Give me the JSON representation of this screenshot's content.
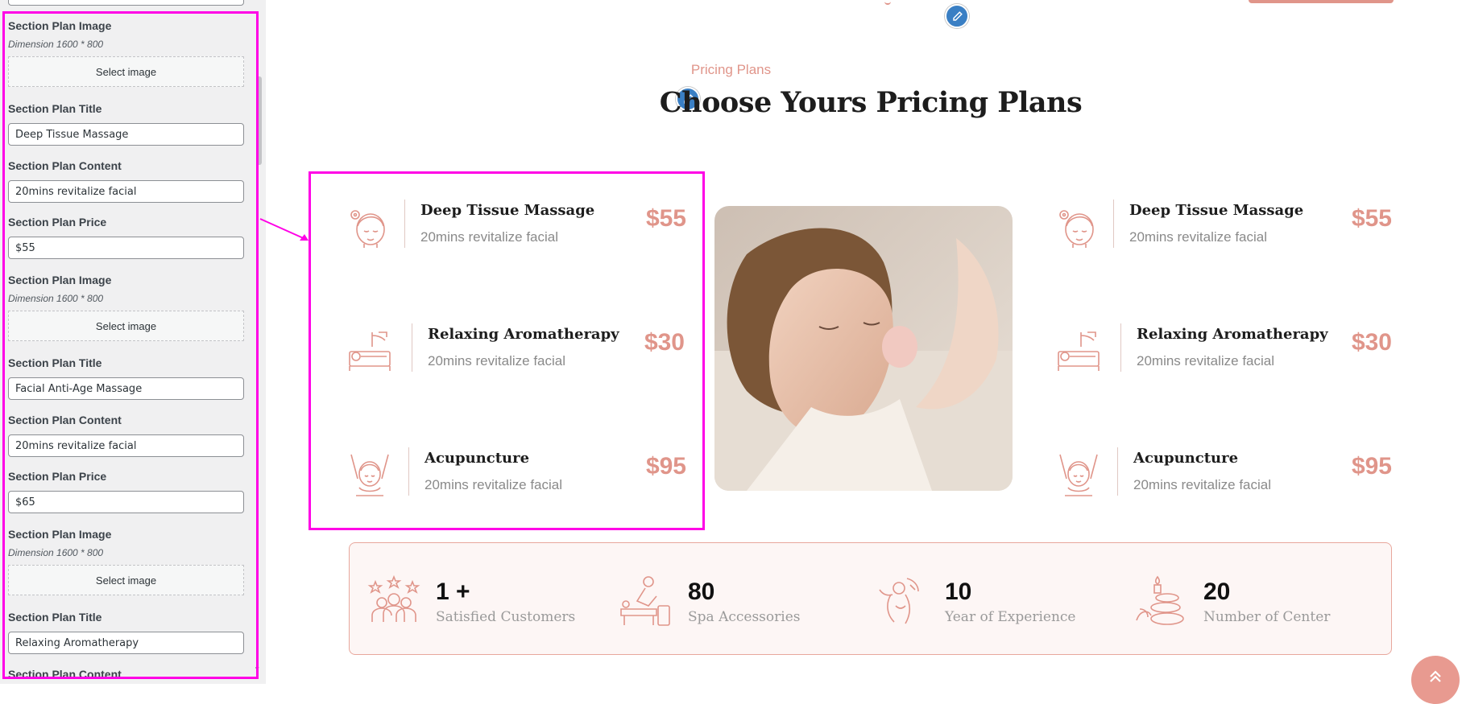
{
  "sidebar": {
    "fields": [
      {
        "type": "image",
        "label": "Section Plan Image",
        "desc": "Dimension 1600 * 800",
        "button": "Select image"
      },
      {
        "type": "text",
        "label": "Section Plan Title",
        "value": "Deep Tissue Massage"
      },
      {
        "type": "text",
        "label": "Section Plan Content",
        "value": "20mins revitalize facial"
      },
      {
        "type": "text",
        "label": "Section Plan Price",
        "value": "$55"
      },
      {
        "type": "image",
        "label": "Section Plan Image",
        "desc": "Dimension 1600 * 800",
        "button": "Select image"
      },
      {
        "type": "text",
        "label": "Section Plan Title",
        "value": "Facial Anti-Age Massage"
      },
      {
        "type": "text",
        "label": "Section Plan Content",
        "value": "20mins revitalize facial"
      },
      {
        "type": "text",
        "label": "Section Plan Price",
        "value": "$65"
      },
      {
        "type": "image",
        "label": "Section Plan Image",
        "desc": "Dimension 1600 * 800",
        "button": "Select image"
      },
      {
        "type": "text",
        "label": "Section Plan Title",
        "value": "Relaxing Aromatherapy"
      },
      {
        "type": "label",
        "label": "Section Plan Content"
      }
    ]
  },
  "preview": {
    "eyebrow": "Pricing Plans",
    "title": "Choose Yours Pricing Plans",
    "left_plans": [
      {
        "icon": "face-flower-icon",
        "name": "Deep Tissue Massage",
        "desc": "20mins revitalize facial",
        "price": "$55"
      },
      {
        "icon": "massage-bed-icon",
        "name": "Relaxing Aromatherapy",
        "desc": "20mins revitalize facial",
        "price": "$30"
      },
      {
        "icon": "face-hands-icon",
        "name": "Acupuncture",
        "desc": "20mins revitalize facial",
        "price": "$95"
      }
    ],
    "right_plans": [
      {
        "icon": "face-flower-icon",
        "name": "Deep Tissue Massage",
        "desc": "20mins revitalize facial",
        "price": "$55"
      },
      {
        "icon": "massage-bed-icon",
        "name": "Relaxing Aromatherapy",
        "desc": "20mins revitalize facial",
        "price": "$30"
      },
      {
        "icon": "face-hands-icon",
        "name": "Acupuncture",
        "desc": "20mins revitalize facial",
        "price": "$95"
      }
    ],
    "photo": "facial-massage-photo",
    "stats": [
      {
        "icon": "customers-stars-icon",
        "number": "1 +",
        "label": "Satisfied Customers"
      },
      {
        "icon": "massage-therapist-icon",
        "number": "80",
        "label": "Spa Accessories"
      },
      {
        "icon": "hand-massage-icon",
        "number": "10",
        "label": "Year of Experience"
      },
      {
        "icon": "spa-stones-candle-icon",
        "number": "20",
        "label": "Number of Center"
      }
    ]
  },
  "colors": {
    "accent": "#e0958a",
    "highlight": "#ff00e6",
    "edit_icon": "#3a7fc4"
  }
}
